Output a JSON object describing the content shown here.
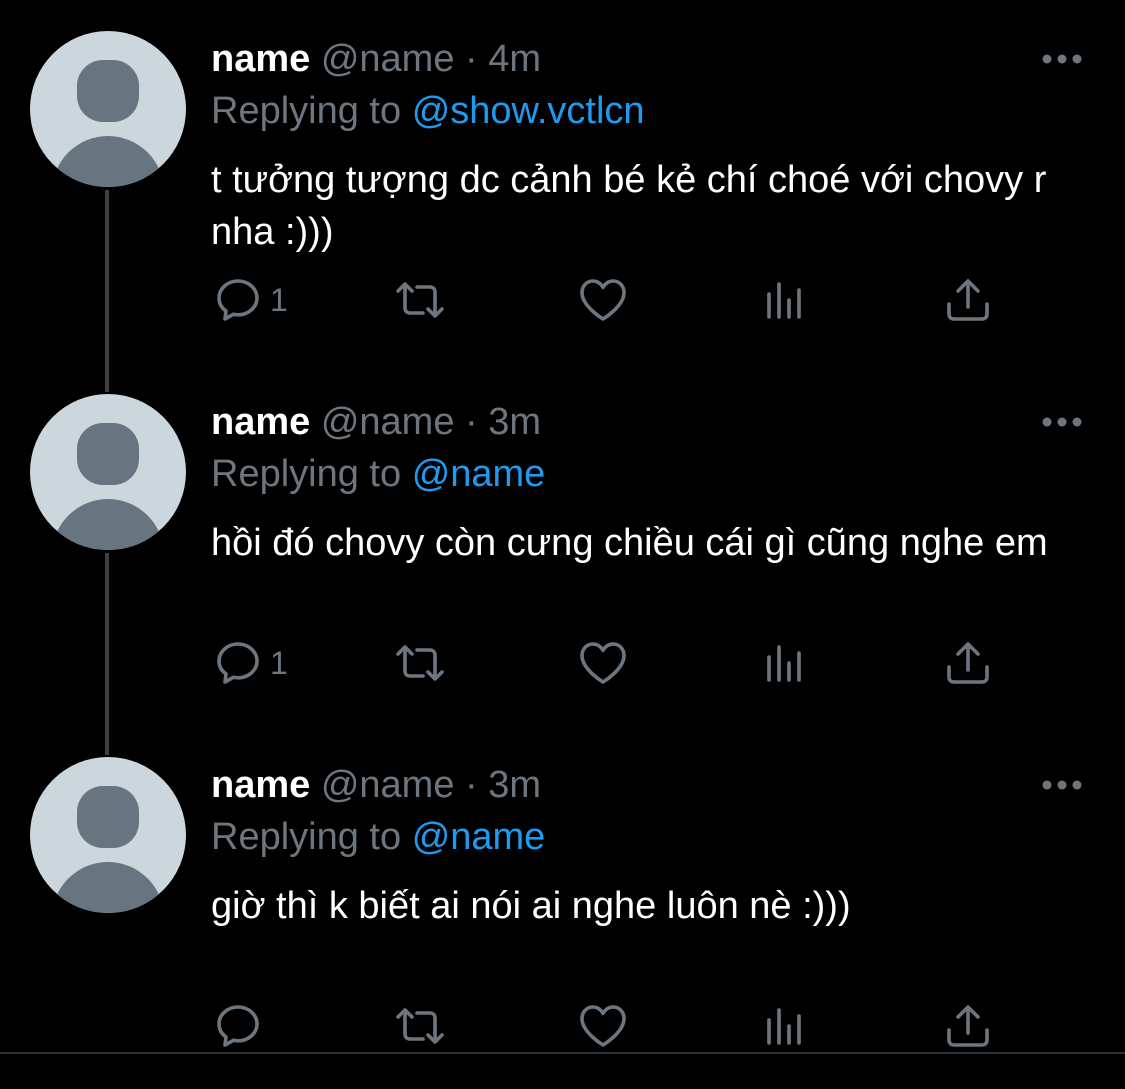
{
  "colors": {
    "background": "#000000",
    "text": "#ffffff",
    "muted": "#6e767d",
    "accent": "#1d9bf0",
    "thread_line": "#3d3f43",
    "avatar_bg": "#ccd6dd",
    "avatar_fg": "#66757f"
  },
  "tweets": [
    {
      "display_name": "name",
      "handle": "@name",
      "dot": "·",
      "time": "4m",
      "replying_label": "Replying to",
      "replying_handle": "@show.vctlcn",
      "text": "t tưởng tượng dc cảnh bé kẻ chí choé với chovy r nha :)))",
      "reply_count": "1"
    },
    {
      "display_name": "name",
      "handle": "@name",
      "dot": "·",
      "time": "3m",
      "replying_label": "Replying to",
      "replying_handle": "@name",
      "text": "hồi đó chovy còn cưng chiều cái gì cũng nghe em",
      "reply_count": "1"
    },
    {
      "display_name": "name",
      "handle": "@name",
      "dot": "·",
      "time": "3m",
      "replying_label": "Replying to",
      "replying_handle": "@name",
      "text": "giờ thì k biết ai nói ai nghe luôn nè :)))",
      "reply_count": ""
    }
  ],
  "icons": {
    "reply": "reply-icon",
    "retweet": "retweet-icon",
    "like": "heart-icon",
    "analytics": "analytics-icon",
    "share": "share-icon",
    "more": "more-icon"
  }
}
